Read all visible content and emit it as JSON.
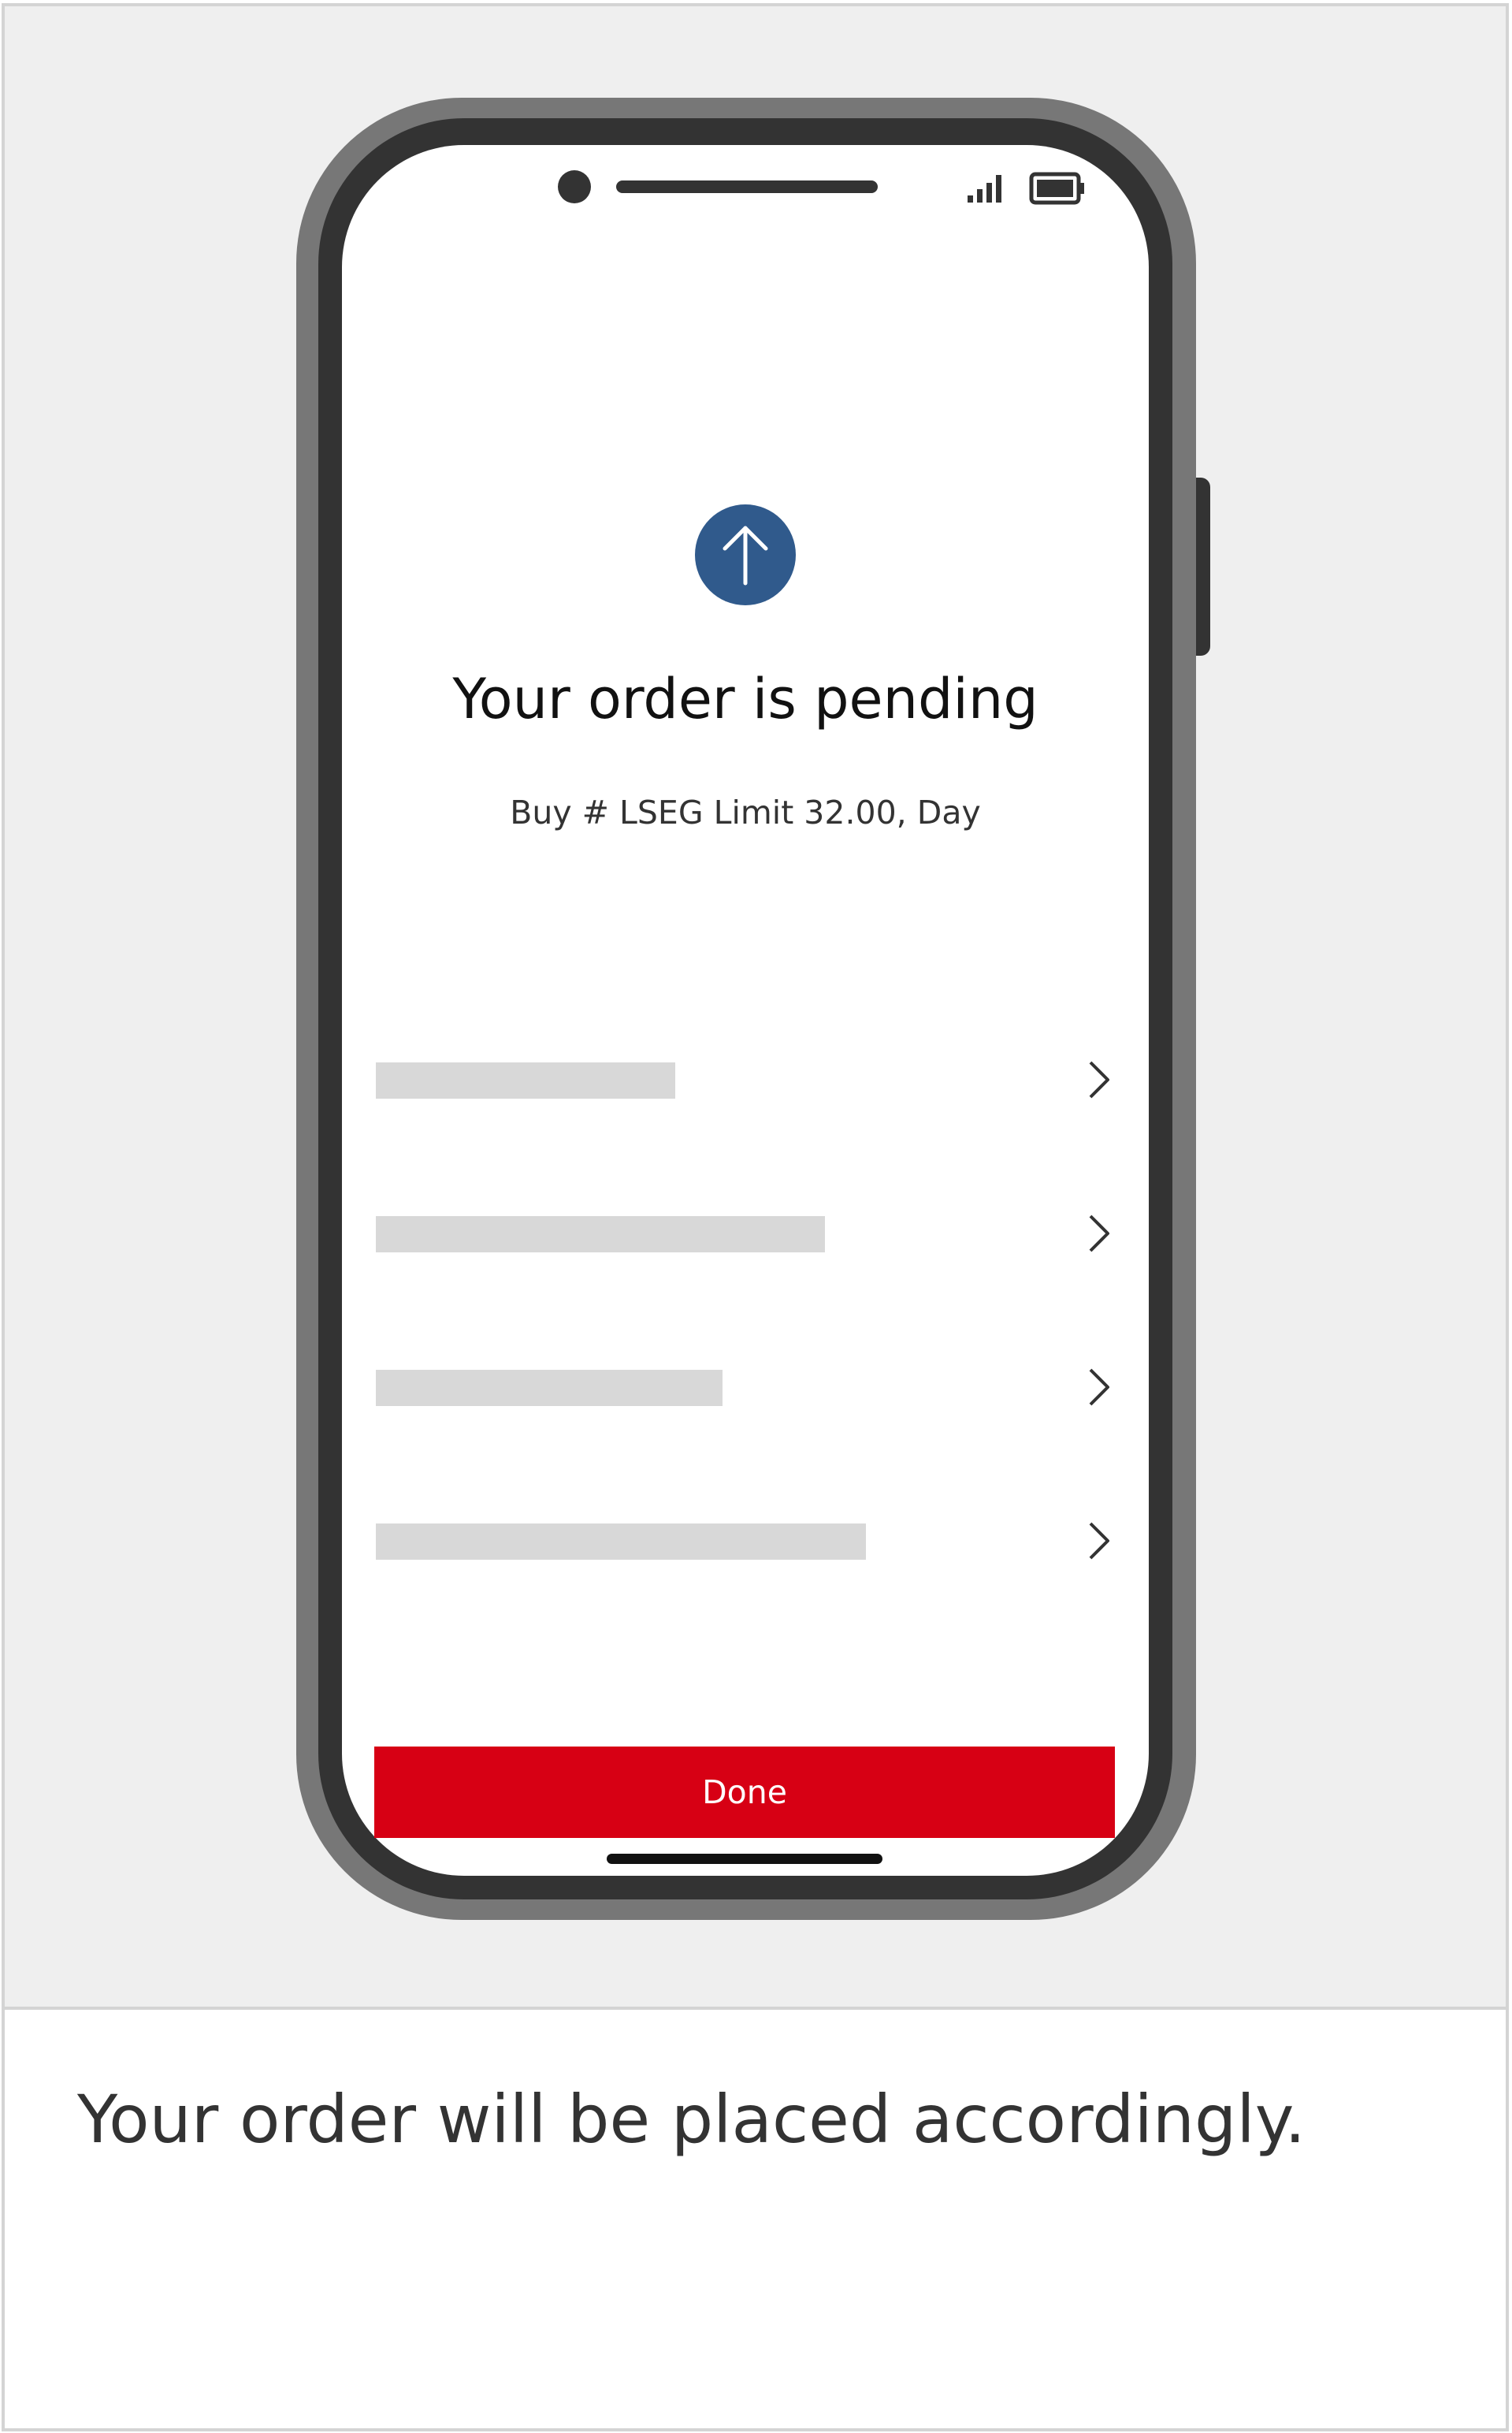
{
  "illustration": {
    "status_bar": {
      "signal_icon": "signal-bars-icon",
      "battery_icon": "battery-icon"
    },
    "hero_icon": "arrow-up-circle-icon",
    "title": "Your order is pending",
    "subtitle": "Buy # LSEG Limit 32.00, Day",
    "rows": [
      {
        "chevron_icon": "chevron-right-icon"
      },
      {
        "chevron_icon": "chevron-right-icon"
      },
      {
        "chevron_icon": "chevron-right-icon"
      },
      {
        "chevron_icon": "chevron-right-icon"
      }
    ],
    "done_label": "Done"
  },
  "caption": "Your order will be placed accordingly.",
  "colors": {
    "accent_red": "#d70014",
    "icon_blue": "#305a8c",
    "phone_dark": "#333333",
    "phone_frame": "#777777",
    "panel_bg": "#efefef",
    "placeholder": "#d8d8d8"
  }
}
